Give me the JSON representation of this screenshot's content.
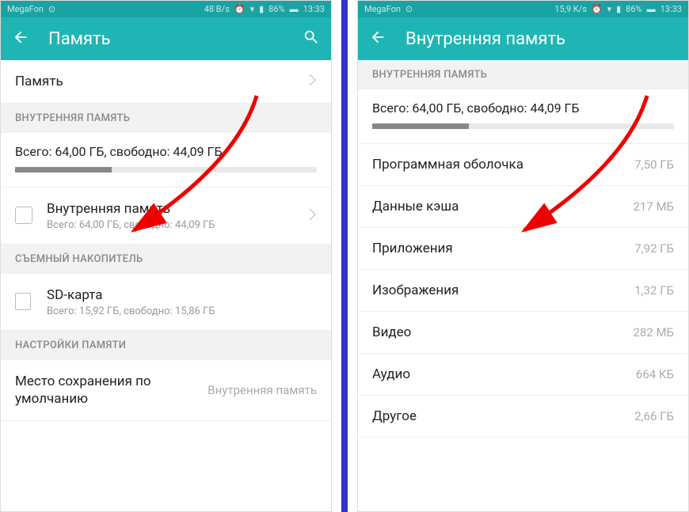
{
  "left": {
    "status": {
      "carrier": "MegaFon",
      "speed": "48 B/s",
      "battery": "86%",
      "time": "13:33"
    },
    "appbar": {
      "title": "Память"
    },
    "row_memory_label": "Память",
    "section_internal": "ВНУТРЕННЯЯ ПАМЯТЬ",
    "summary_text": "Всего: 64,00 ГБ, свободно: 44,09 ГБ",
    "progress_pct": 32,
    "internal_item": {
      "label": "Внутренняя память",
      "sub": "Всего: 64,00 ГБ, свободно: 44,09 ГБ"
    },
    "section_removable": "СЪЕМНЫЙ НАКОПИТЕЛЬ",
    "sd_item": {
      "label": "SD-карта",
      "sub": "Всего: 15,92 ГБ, свободно: 15,86 ГБ"
    },
    "section_settings": "НАСТРОЙКИ ПАМЯТИ",
    "default_storage": {
      "label": "Место сохранения по умолчанию",
      "value": "Внутренняя память"
    }
  },
  "right": {
    "status": {
      "carrier": "MegaFon",
      "speed": "15,9 K/s",
      "battery": "86%",
      "time": "13:33"
    },
    "appbar": {
      "title": "Внутренняя память"
    },
    "section_internal": "ВНУТРЕННЯЯ ПАМЯТЬ",
    "summary_text": "Всего: 64,00 ГБ, свободно: 44,09 ГБ",
    "progress_pct": 32,
    "rows": [
      {
        "label": "Программная оболочка",
        "value": "7,50 ГБ"
      },
      {
        "label": "Данные кэша",
        "value": "217 МБ"
      },
      {
        "label": "Приложения",
        "value": "7,92 ГБ"
      },
      {
        "label": "Изображения",
        "value": "1,32 ГБ"
      },
      {
        "label": "Видео",
        "value": "282 МБ"
      },
      {
        "label": "Аудио",
        "value": "664 КБ"
      },
      {
        "label": "Другое",
        "value": "2,66 ГБ"
      }
    ]
  }
}
